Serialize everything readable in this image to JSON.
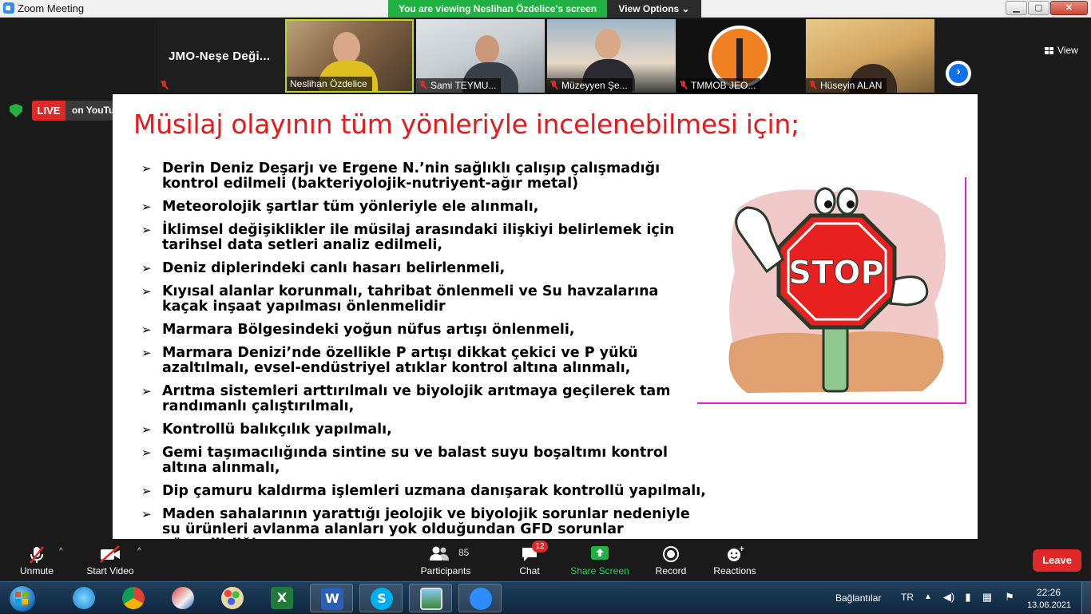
{
  "window": {
    "title": "Zoom Meeting",
    "viewing_banner": "You are viewing Neslihan Özdelice's screen",
    "view_options": "View Options ⌄",
    "minimize": "▁",
    "maximize": "▢",
    "close": "✕"
  },
  "gallery": {
    "tiles": [
      {
        "display_name": "JMO-Neşe  Deği...",
        "label": "",
        "muted": true
      },
      {
        "label": "Neslihan Özdelice",
        "muted": false,
        "active_speaker": true
      },
      {
        "label": "Sami TEYMU...",
        "muted": true
      },
      {
        "label": "Müzeyyen Şe...",
        "muted": true
      },
      {
        "label": "TMMOB JEO...",
        "muted": true
      },
      {
        "label": "Hüseyin ALAN",
        "muted": true
      }
    ],
    "next_arrow": "›",
    "view_label": "View"
  },
  "live": {
    "live_label": "LIVE",
    "platform_label": "on YouTube ▾"
  },
  "slide": {
    "title": "Müsilaj olayının tüm yönleriyle incelenebilmesi için;",
    "bullet_glyph": "➢",
    "bullets": [
      "Derin Deniz Deşarjı ve Ergene N.’nin sağlıklı çalışıp çalışmadığı kontrol edilmeli (bakteriyolojik-nutriyent-ağır metal)",
      "Meteorolojik şartlar tüm yönleriyle ele alınmalı,",
      "İklimsel değişiklikler ile müsilaj arasındaki ilişkiyi belirlemek için tarihsel data setleri analiz edilmeli,",
      "Deniz diplerindeki canlı hasarı belirlenmeli,",
      "Kıyısal alanlar korunmalı, tahribat önlenmeli ve Su havzalarına kaçak inşaat yapılması önlenmelidir",
      "Marmara Bölgesindeki yoğun nüfus artışı önlenmeli,",
      "Marmara Denizi’nde özellikle P artışı dikkat çekici ve P yükü azaltılmalı, evsel-endüstriyel atıklar kontrol altına alınmalı,",
      "Arıtma sistemleri arttırılmalı ve biyolojik arıtmaya geçilerek tam randımanlı çalıştırılmalı,",
      "Kontrollü balıkçılık yapılmalı,",
      "Gemi taşımacılığında sintine su ve balast suyu boşaltımı kontrol altına alınmalı,",
      "Dip çamuru kaldırma işlemleri uzmana danışarak kontrollü yapılmalı,",
      "Maden sahalarının yarattığı jeolojik ve biyolojik sorunlar nedeniyle su ürünleri avlanma alanları yok olduğundan GFD sorunlar güvenilirliği"
    ],
    "stop_sign_text": "STOP"
  },
  "toolbar": {
    "unmute": "Unmute",
    "start_video": "Start Video",
    "participants": "Participants",
    "participants_count": "85",
    "chat": "Chat",
    "chat_badge": "12",
    "share_screen": "Share Screen",
    "record": "Record",
    "reactions": "Reactions",
    "leave": "Leave",
    "caret": "^"
  },
  "taskbar": {
    "links_label": "Bağlantılar",
    "language": "TR",
    "tray_expand": "▲",
    "time": "22:26",
    "date": "13.06.2021",
    "apps": [
      "internet-explorer",
      "chrome",
      "snipping-tool",
      "paint",
      "excel",
      "word",
      "skype",
      "photo-viewer",
      "zoom"
    ]
  },
  "colors": {
    "accent_green": "#1fb141",
    "live_red": "#e02828",
    "title_red": "#e8191c",
    "frame_magenta": "#e020c0"
  }
}
